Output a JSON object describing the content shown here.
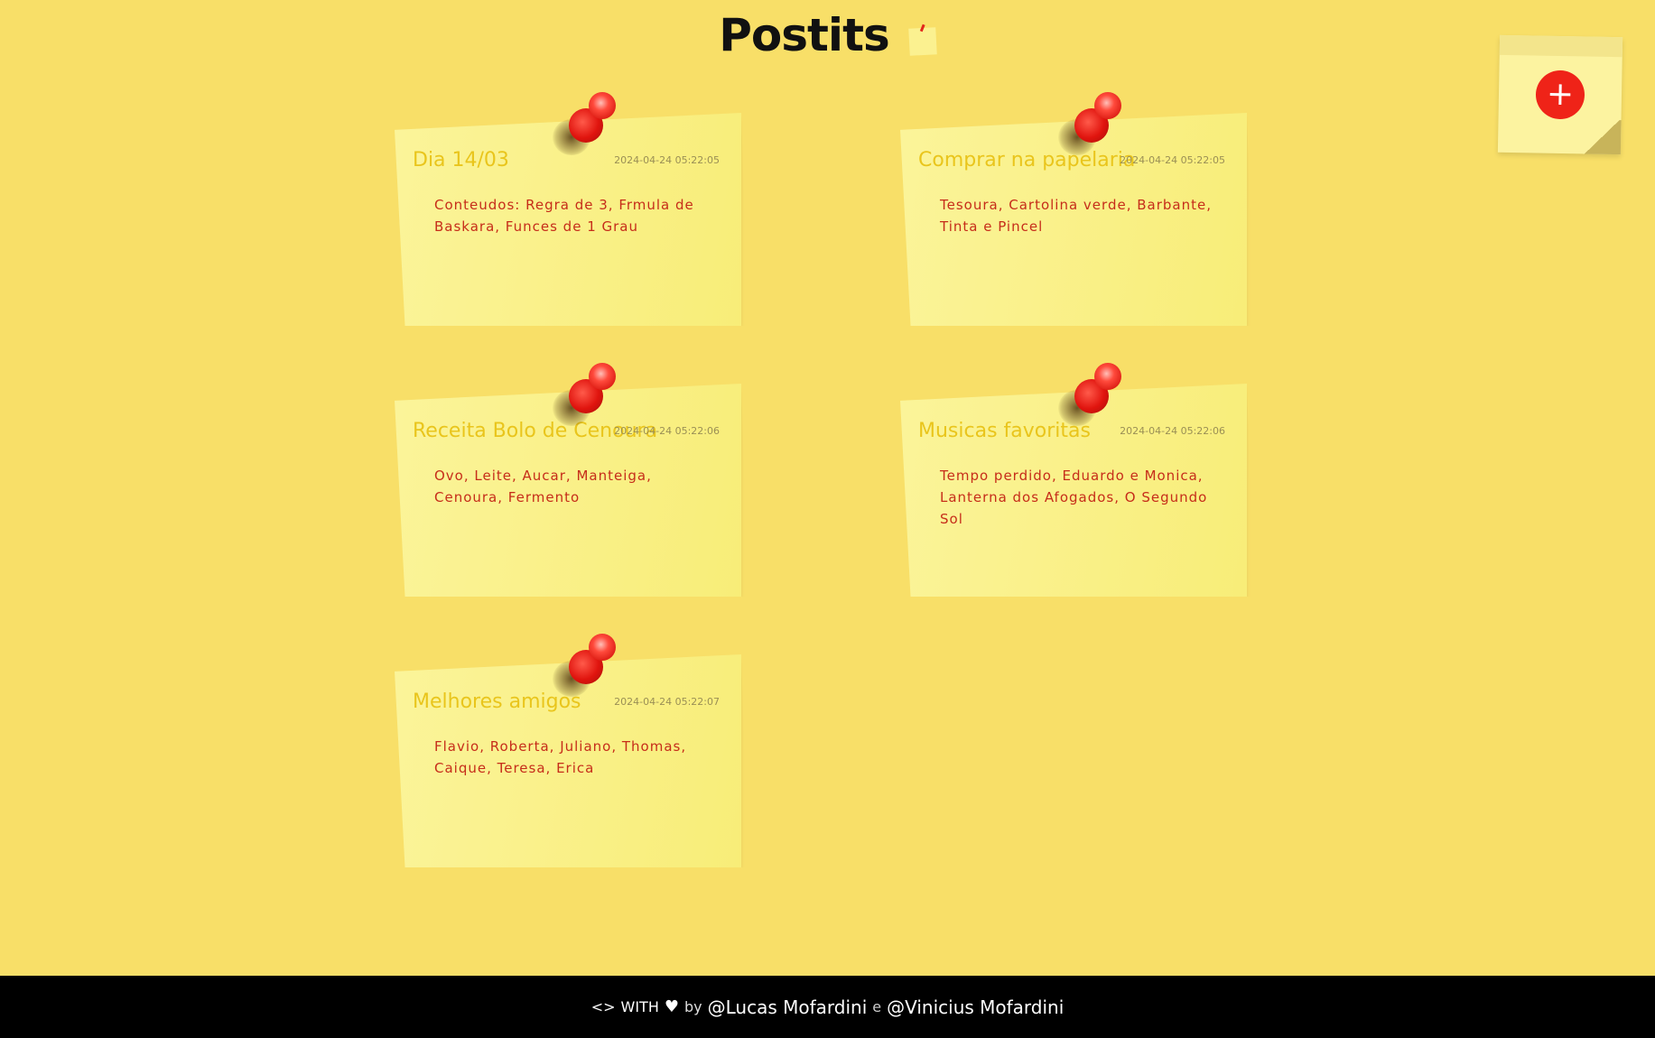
{
  "header": {
    "title": "Postits",
    "logo_icon": "sticky-note-icon"
  },
  "add_note": {
    "button_label": "+",
    "icon": "plus-icon"
  },
  "notes": [
    {
      "title": "Dia 14/03",
      "date": "2024-04-24 05:22:05",
      "body": "Conteudos: Regra de 3, Frmula de Baskara, Funces de 1 Grau"
    },
    {
      "title": "Comprar na papelaria",
      "date": "2024-04-24 05:22:05",
      "body": "Tesoura, Cartolina verde, Barbante, Tinta e Pincel"
    },
    {
      "title": "Receita Bolo de Cenoura",
      "date": "2024-04-24 05:22:06",
      "body": "Ovo, Leite, Aucar, Manteiga, Cenoura, Fermento"
    },
    {
      "title": "Musicas favoritas",
      "date": "2024-04-24 05:22:06",
      "body": "Tempo perdido, Eduardo e Monica, Lanterna dos Afogados, O Segundo Sol"
    },
    {
      "title": "Melhores amigos",
      "date": "2024-04-24 05:22:07",
      "body": "Flavio, Roberta, Juliano, Thomas, Caique, Teresa, Erica"
    }
  ],
  "footer": {
    "code": "<>",
    "with": "WITH",
    "heart": "♥",
    "by": "by",
    "author1": "@Lucas Mofardini",
    "and": "e",
    "author2": "@Vinicius Mofardini"
  },
  "colors": {
    "background": "#f8df68",
    "note": "#fbf49a",
    "note_title": "#e9c51c",
    "note_body": "#c62d1a",
    "pin": "#e0140e",
    "footer": "#000000"
  }
}
